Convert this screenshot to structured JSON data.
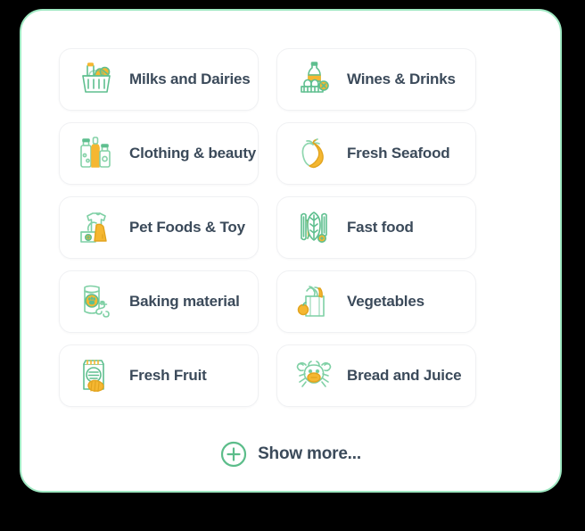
{
  "panel": {
    "border_color": "#9fe8c2",
    "background_color": "#ffffff"
  },
  "theme": {
    "text_color": "#3b4a5a",
    "icon_green": "#5fbf8f",
    "icon_green_light": "#a8dcc0",
    "icon_yellow": "#f5b731",
    "accent_green": "#5cbd8a",
    "card_border": "#f0f1f3"
  },
  "categories": [
    {
      "label": "Milks and Dairies",
      "icon": "grocery-basket-icon"
    },
    {
      "label": "Wines & Drinks",
      "icon": "bottle-and-eggs-icon"
    },
    {
      "label": "Clothing & beauty",
      "icon": "bottles-icon"
    },
    {
      "label": "Fresh Seafood",
      "icon": "apple-banana-icon"
    },
    {
      "label": "Pet Foods & Toy",
      "icon": "clothing-icon"
    },
    {
      "label": "Fast food",
      "icon": "vegetables-icon"
    },
    {
      "label": "Baking material",
      "icon": "pet-food-bag-icon"
    },
    {
      "label": "Vegetables",
      "icon": "grocery-bag-icon"
    },
    {
      "label": "Fresh Fruit",
      "icon": "bread-package-icon"
    },
    {
      "label": "Bread and Juice",
      "icon": "crab-icon"
    }
  ],
  "show_more": {
    "label": "Show more...",
    "icon": "plus-circle-icon"
  }
}
